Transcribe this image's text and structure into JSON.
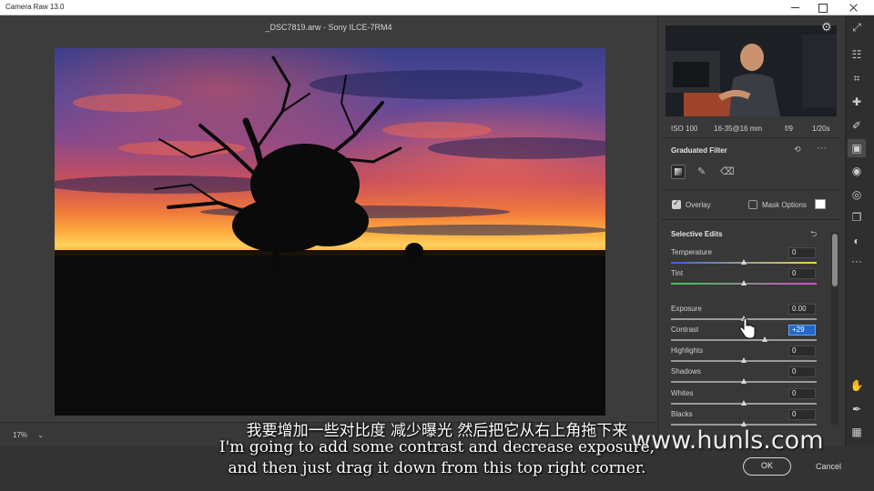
{
  "window": {
    "title": "Camera Raw 13.0"
  },
  "canvas": {
    "filename": "_DSC7819.arw  -  Sony ILCE-7RM4"
  },
  "bottom": {
    "zoom": "17%",
    "ok": "OK",
    "cancel": "Cancel"
  },
  "meta": {
    "iso": "ISO 100",
    "lens": "16-35@16 mm",
    "aperture": "f/9",
    "shutter": "1/20s"
  },
  "graduated_filter": {
    "title": "Graduated Filter",
    "overlay_label": "Overlay",
    "overlay_checked": true,
    "mask_options_label": "Mask Options",
    "mask_options_checked": false
  },
  "selective_edits": {
    "title": "Selective Edits",
    "sliders": [
      {
        "label": "Temperature",
        "value": "0",
        "level": 0.5,
        "gradient": "temp"
      },
      {
        "label": "Tint",
        "value": "0",
        "level": 0.5,
        "gradient": "tint"
      },
      {
        "label": "Exposure",
        "value": "0.00",
        "level": 0.5,
        "gradient": "plain"
      },
      {
        "label": "Contrast",
        "value": "+29",
        "level": 0.645,
        "gradient": "plain",
        "active": true
      },
      {
        "label": "Highlights",
        "value": "0",
        "level": 0.5,
        "gradient": "plain"
      },
      {
        "label": "Shadows",
        "value": "0",
        "level": 0.5,
        "gradient": "plain"
      },
      {
        "label": "Whites",
        "value": "0",
        "level": 0.5,
        "gradient": "plain"
      },
      {
        "label": "Blacks",
        "value": "0",
        "level": 0.5,
        "gradient": "plain"
      }
    ]
  },
  "subtitles": {
    "cn": "我要增加一些对比度 减少曝光 然后把它从右上角拖下来",
    "en1": "I'm going to add some contrast and decrease exposure,",
    "en2": "and then just drag it down from this top right corner."
  },
  "watermark": "www.hunls.com",
  "toolbar_icons": [
    "expand-icon",
    "edit-sliders-icon",
    "crop-icon",
    "healing-icon",
    "brush-icon",
    "graduated-filter-icon",
    "radial-filter-icon",
    "red-eye-icon",
    "snapshots-icon",
    "presets-icon",
    "more-icon",
    "hand-icon",
    "color-sampler-icon",
    "grid-icon"
  ]
}
